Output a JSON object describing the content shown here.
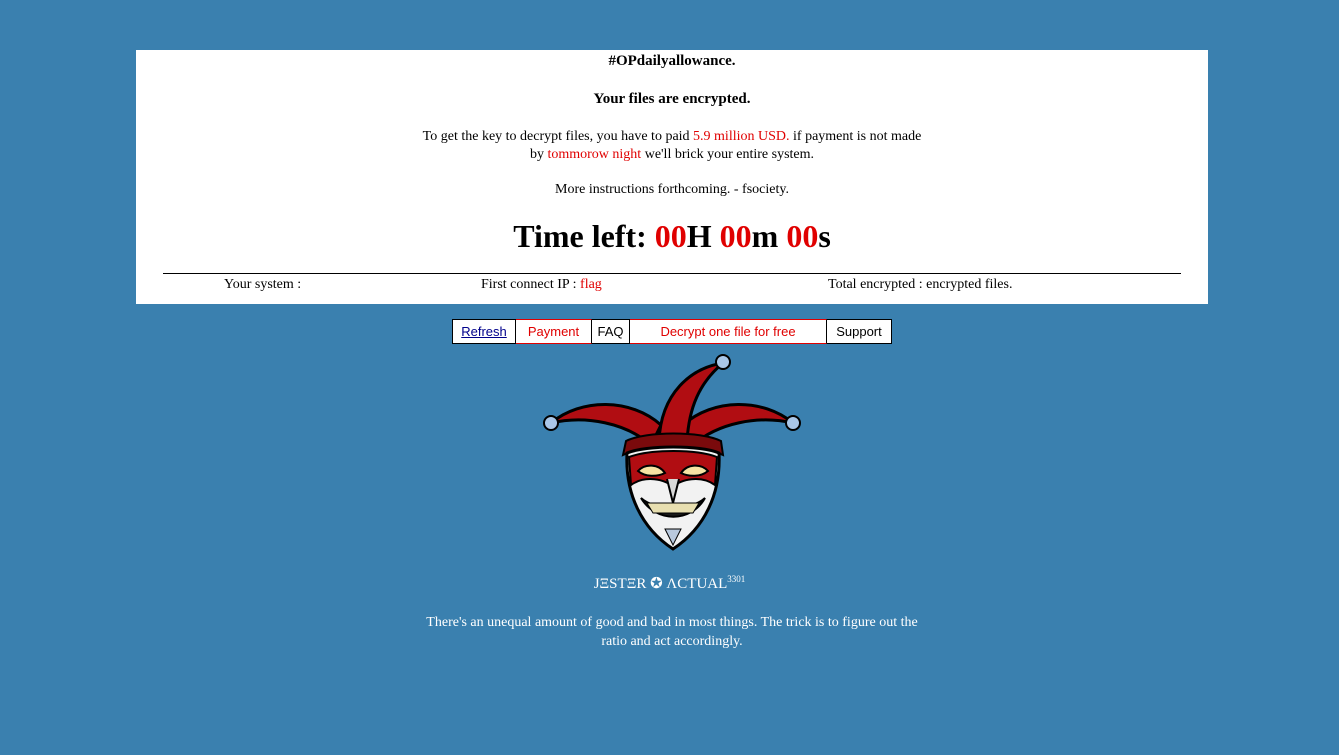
{
  "panel": {
    "hashtag": "#OPdailyallowance.",
    "headline": "Your files are encrypted.",
    "message": {
      "line1_pre": "To get the key to decrypt files, you have to paid ",
      "amount": "5.9 million USD.",
      "line1_post": " if payment is not made",
      "line2_pre": "by ",
      "deadline": "tommorow night",
      "line2_post": " we'll brick your entire system."
    },
    "instructions": "More instructions forthcoming. - fsociety.",
    "timer": {
      "label": "Time left: ",
      "hours": "00",
      "hours_unit": "H ",
      "minutes": "00",
      "minutes_unit": "m ",
      "seconds": "00",
      "seconds_unit": "s"
    },
    "info": {
      "system_label": "Your system :",
      "ip_label": "First connect IP : ",
      "ip_value": "flag",
      "encrypted_label": "Total encrypted : encrypted files."
    }
  },
  "toolbar": {
    "refresh": "Refresh",
    "payment": "Payment",
    "faq": "FAQ",
    "decrypt": "Decrypt one file for free",
    "support": "Support"
  },
  "signature": {
    "name": "JΞSTΞR ✪ ΛCTUAL",
    "sup": "3301"
  },
  "quote": "There's an unequal amount of good and bad in most things. The trick is to figure out the ratio and act accordingly.",
  "colors": {
    "background": "#3a80af",
    "accent_red": "#e00000",
    "panel": "#ffffff"
  }
}
